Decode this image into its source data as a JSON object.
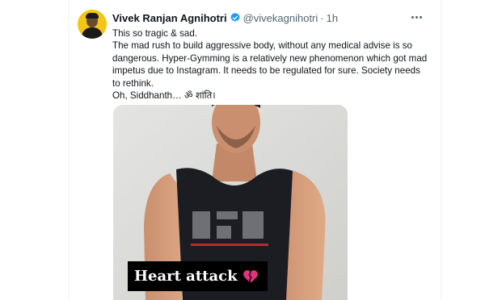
{
  "tweet": {
    "display_name": "Vivek Ranjan Agnihotri",
    "handle": "@vivekagnihotri",
    "separator": "·",
    "time": "1h",
    "verified_icon": "verified-badge-icon",
    "more_icon": "more-options-icon",
    "text_lines": [
      "This so tragic & sad.",
      "The mad rush to build aggressive body, without any medical advise is so dangerous. Hyper-Gymming is a relatively new phenomenon which got mad impetus due to Instagram. It needs to be regulated for sure. Society needs to rethink.",
      "Oh, Siddhanth… ॐ शांति।"
    ],
    "media": {
      "caption": "Heart attack",
      "caption_icon": "broken-heart-icon",
      "accent_color": "#1d9bf0"
    }
  }
}
